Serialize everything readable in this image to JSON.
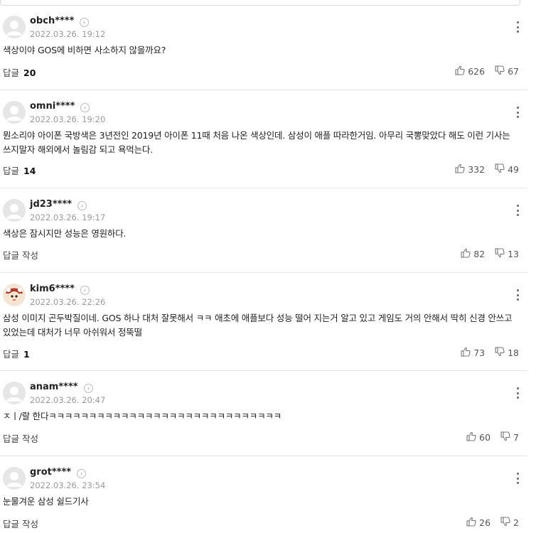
{
  "comments": [
    {
      "nick": "obch****",
      "date": "2022.03.26. 19:12",
      "text": "색상이야 GOS에 비하면 사소하지 않을까요?",
      "reply_label": "답글",
      "reply_count": "20",
      "likes": "626",
      "dislikes": "67",
      "avatar": "default"
    },
    {
      "nick": "omni****",
      "date": "2022.03.26. 19:20",
      "text": "뭔소리야 아이폰 국방색은 3년전인 2019년 아이폰 11때 처음 나온 색상인데. 삼성이 애플 따라한거임. 아무리 국뽕맞았다 해도 이런 기사는 쓰지말자 해외에서 놀림감 되고 욕먹는다.",
      "reply_label": "답글",
      "reply_count": "14",
      "likes": "332",
      "dislikes": "49",
      "avatar": "default"
    },
    {
      "nick": "jd23****",
      "date": "2022.03.26. 19:17",
      "text": "색상은 잠시지만 성능은 영원하다.",
      "reply_label": "답글 작성",
      "reply_count": "",
      "likes": "82",
      "dislikes": "13",
      "avatar": "default"
    },
    {
      "nick": "kim6****",
      "date": "2022.03.26. 22:26",
      "text": "삼성 이미지 곤두박질이네. GOS 하나 대처 잘못해서 ㅋㅋ 애초에 애플보다 성능 떨어 지는거 알고 있고 게임도 거의 안해서 딱히 신경 안쓰고 있었는데 대처가 너무 아쉬워서 정뚝떨",
      "reply_label": "답글",
      "reply_count": "1",
      "likes": "73",
      "dislikes": "18",
      "avatar": "character"
    },
    {
      "nick": "anam****",
      "date": "2022.03.26. 20:47",
      "text": "ㅈㅣ/랄 한다ㅋㅋㅋㅋㅋㅋㅋㅋㅋㅋㅋㅋㅋㅋㅋㅋㅋㅋㅋㅋㅋㅋㅋㅋㅋㅋㅋㅋㅋ",
      "reply_label": "답글 작성",
      "reply_count": "",
      "likes": "60",
      "dislikes": "7",
      "avatar": "default"
    },
    {
      "nick": "grot****",
      "date": "2022.03.26. 23:54",
      "text": "눈물겨운 삼성 쉴드기사",
      "reply_label": "답글 작성",
      "reply_count": "",
      "likes": "26",
      "dislikes": "2",
      "avatar": "default"
    }
  ]
}
